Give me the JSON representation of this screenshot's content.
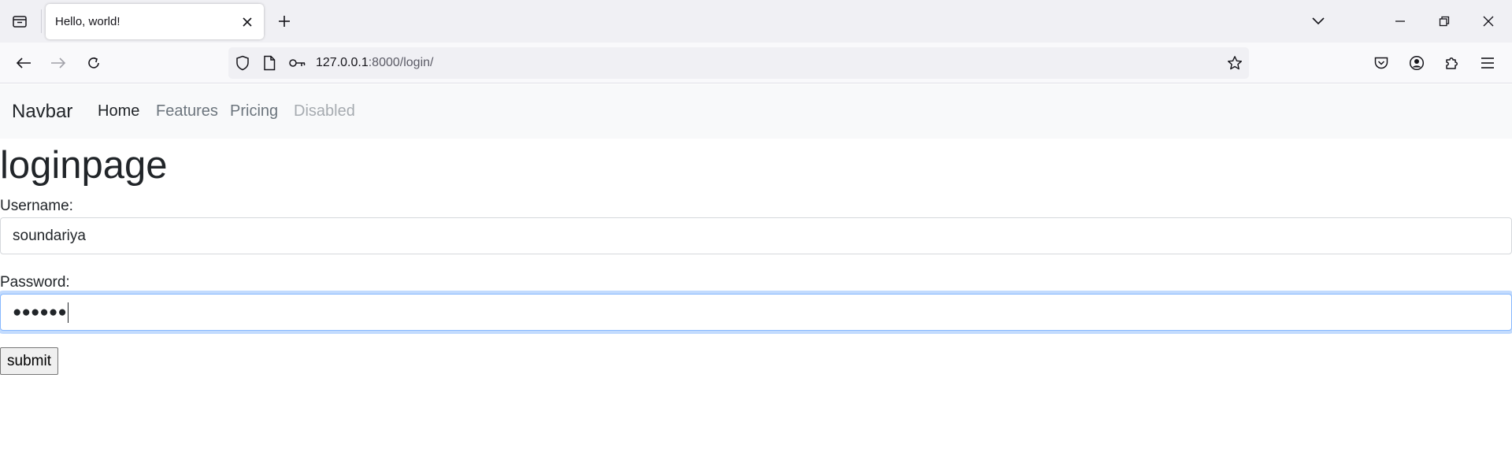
{
  "browser": {
    "tab": {
      "title": "Hello, world!"
    },
    "url": {
      "host": "127.0.0.1",
      "rest": ":8000/login/"
    },
    "icons": {
      "tab_list": "tab-list-icon",
      "tab_close": "close-icon",
      "new_tab": "plus-icon",
      "list_all_tabs": "chevron-down-icon",
      "minimize": "minimize-icon",
      "restore": "restore-icon",
      "close_window": "close-icon",
      "back": "arrow-left-icon",
      "forward": "arrow-right-icon",
      "reload": "reload-icon",
      "shield": "shield-icon",
      "page": "page-icon",
      "key": "key-icon",
      "bookmark": "star-icon",
      "pocket": "pocket-icon",
      "account": "account-icon",
      "extensions": "puzzle-icon",
      "menu": "hamburger-menu-icon"
    }
  },
  "navbar": {
    "brand": "Navbar",
    "links": [
      {
        "label": "Home",
        "state": "active"
      },
      {
        "label": "Features",
        "state": "normal"
      },
      {
        "label": "Pricing",
        "state": "normal"
      },
      {
        "label": "Disabled",
        "state": "disabled"
      }
    ]
  },
  "page": {
    "heading": "loginpage",
    "username": {
      "label": "Username:",
      "value": "soundariya"
    },
    "password": {
      "label": "Password:",
      "masked_value": "●●●●●●"
    },
    "submit_label": "submit"
  },
  "colors": {
    "navbar_bg": "#f8f9fa",
    "focus_ring": "#86b7fe",
    "text": "#212529",
    "muted": "#6c757d"
  }
}
